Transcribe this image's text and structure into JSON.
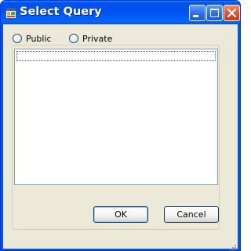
{
  "window": {
    "title": "Select Query"
  },
  "icons": {
    "app": "app-window-icon",
    "minimize": "minimize-icon",
    "maximize": "maximize-icon",
    "close": "close-icon",
    "grip": "resize-grip-icon"
  },
  "options": {
    "public_label": "Public",
    "private_label": "Private"
  },
  "buttons": {
    "ok_label": "OK",
    "cancel_label": "Cancel"
  },
  "colors": {
    "titlebar": "#0054e3",
    "close_button": "#e0522c",
    "window_bg": "#ece9d8",
    "list_border": "#7f9db9"
  }
}
